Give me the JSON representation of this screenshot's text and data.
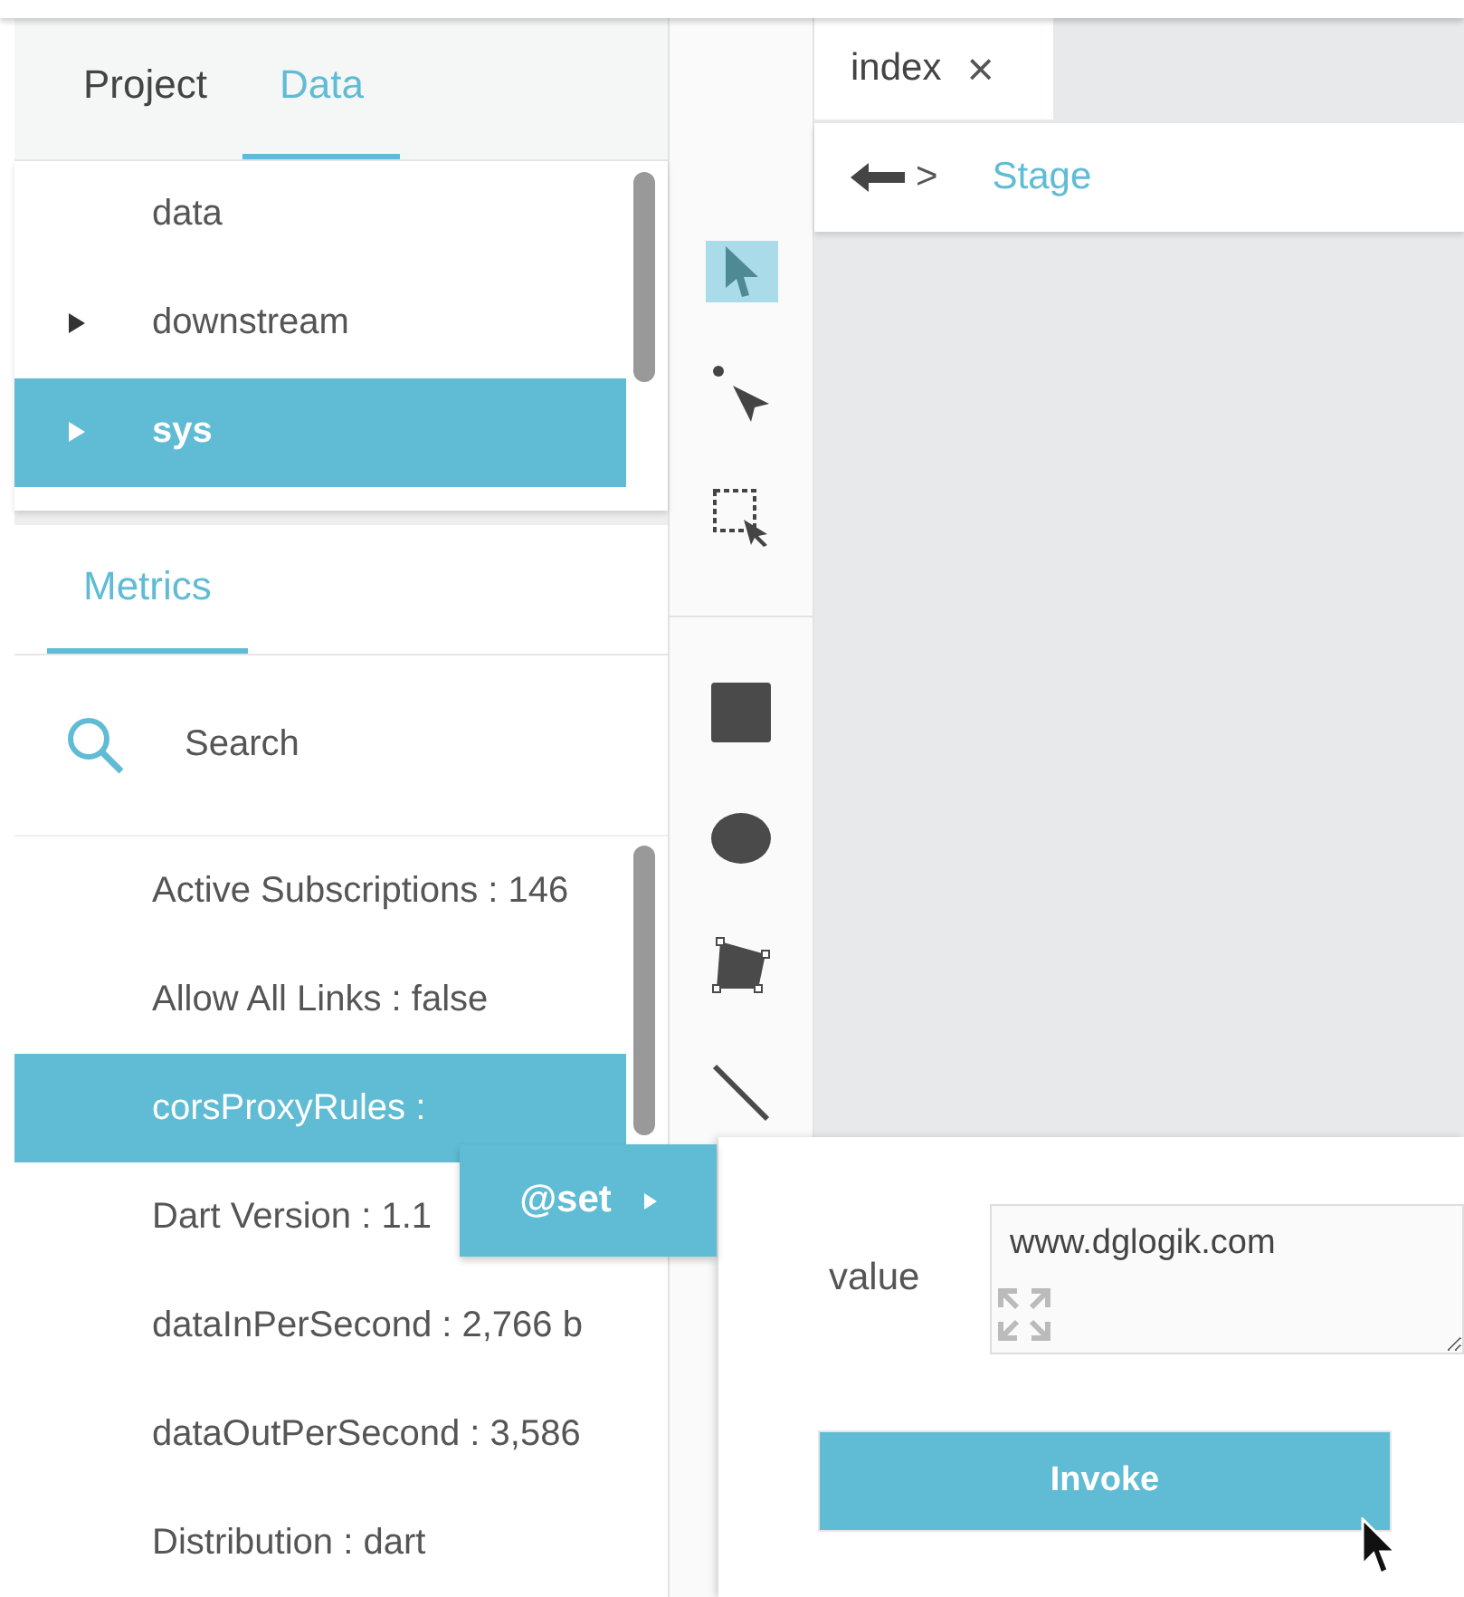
{
  "left_tabs": [
    {
      "label": "Project",
      "selected": false
    },
    {
      "label": "Data",
      "selected": true
    }
  ],
  "tree": [
    {
      "label": "data",
      "expandable": false,
      "selected": false
    },
    {
      "label": "downstream",
      "expandable": true,
      "selected": false
    },
    {
      "label": "sys",
      "expandable": true,
      "selected": true
    }
  ],
  "metrics_tabs": [
    {
      "label": "Metrics",
      "selected": true
    }
  ],
  "search": {
    "placeholder": "Search"
  },
  "metrics": [
    {
      "label": "Active Subscriptions : 146",
      "selected": false
    },
    {
      "label": "Allow All Links : false",
      "selected": false
    },
    {
      "label": "corsProxyRules :",
      "selected": true
    },
    {
      "label": "Dart Version : 1.1",
      "selected": false
    },
    {
      "label": "dataInPerSecond : 2,766 b",
      "selected": false
    },
    {
      "label": "dataOutPerSecond : 3,586",
      "selected": false
    },
    {
      "label": "Distribution : dart",
      "selected": false
    }
  ],
  "tool_groups": [
    [
      {
        "kind": "select",
        "selected": true
      },
      {
        "kind": "point",
        "selected": false
      },
      {
        "kind": "marquee",
        "selected": false
      }
    ],
    [
      {
        "kind": "rect",
        "selected": false
      },
      {
        "kind": "ellipse",
        "selected": false
      },
      {
        "kind": "polygon",
        "selected": false
      },
      {
        "kind": "line",
        "selected": false
      }
    ]
  ],
  "doc_tabs": [
    {
      "label": "index",
      "close": "×",
      "selected": true
    }
  ],
  "breadcrumb": {
    "separator": ">",
    "label": "Stage"
  },
  "context_menu": {
    "label": "@set"
  },
  "invoke_panel": {
    "field_label": "value",
    "value": "www.dglogik.com",
    "button": "Invoke"
  }
}
